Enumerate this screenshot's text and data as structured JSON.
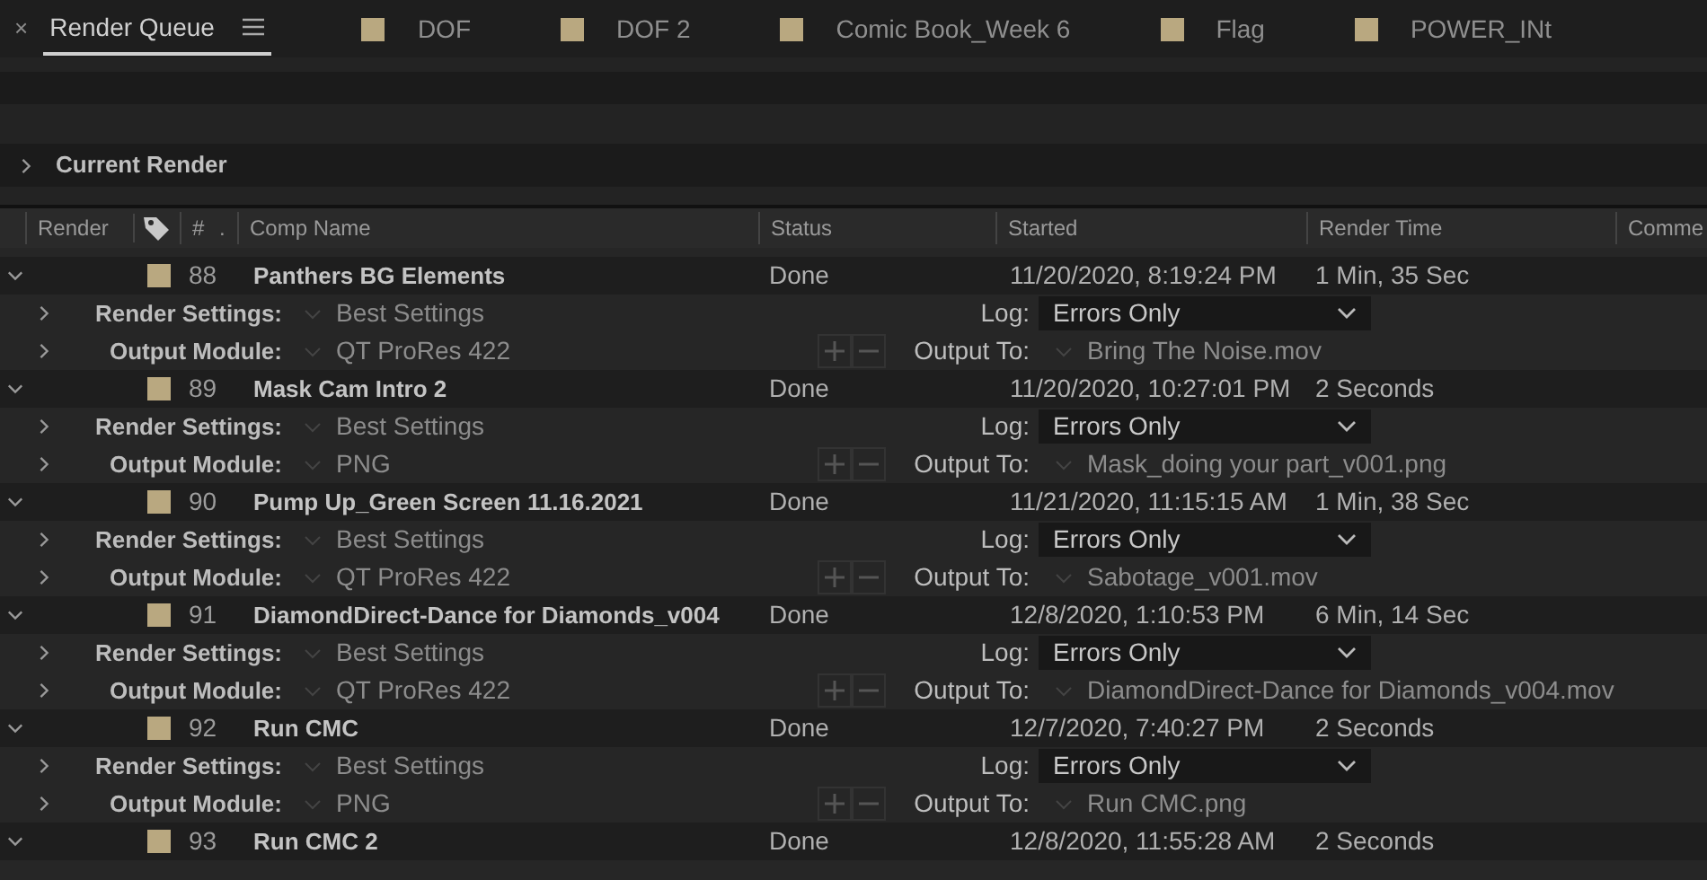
{
  "tabs": [
    {
      "kind": "queue",
      "label": "Render Queue",
      "selected": true
    },
    {
      "kind": "comp",
      "label": "DOF",
      "selected": false
    },
    {
      "kind": "comp",
      "label": "DOF 2",
      "selected": false
    },
    {
      "kind": "comp",
      "label": "Comic Book_Week 6",
      "selected": false
    },
    {
      "kind": "comp",
      "label": "Flag",
      "selected": false
    },
    {
      "kind": "comp",
      "label": "POWER_INt",
      "selected": false
    }
  ],
  "close_tab": "×",
  "current_render": {
    "label": "Current Render",
    "expanded": false
  },
  "columns": [
    "Render",
    "#",
    ".",
    "Comp Name",
    "Status",
    "Started",
    "Render Time",
    "Comme"
  ],
  "items": [
    {
      "number": "88",
      "name": "Panthers BG Elements",
      "status": "Done",
      "started": "11/20/2020, 8:19:24 PM",
      "render_time": "1 Min, 35 Sec",
      "expanded": true,
      "render_settings_label": "Render Settings:",
      "render_settings": "Best Settings",
      "log_label": "Log:",
      "log": "Errors Only",
      "output_module_label": "Output Module:",
      "output_module": "QT ProRes 422",
      "output_to_label": "Output To:",
      "output_to": "Bring The Noise.mov"
    },
    {
      "number": "89",
      "name": "Mask Cam Intro 2",
      "status": "Done",
      "started": "11/20/2020, 10:27:01 PM",
      "render_time": "2 Seconds",
      "expanded": true,
      "render_settings_label": "Render Settings:",
      "render_settings": "Best Settings",
      "log_label": "Log:",
      "log": "Errors Only",
      "output_module_label": "Output Module:",
      "output_module": "PNG",
      "output_to_label": "Output To:",
      "output_to": "Mask_doing your part_v001.png"
    },
    {
      "number": "90",
      "name": "Pump Up_Green Screen 11.16.2021",
      "status": "Done",
      "started": "11/21/2020, 11:15:15 AM",
      "render_time": "1 Min, 38 Sec",
      "expanded": true,
      "render_settings_label": "Render Settings:",
      "render_settings": "Best Settings",
      "log_label": "Log:",
      "log": "Errors Only",
      "output_module_label": "Output Module:",
      "output_module": "QT ProRes 422",
      "output_to_label": "Output To:",
      "output_to": "Sabotage_v001.mov"
    },
    {
      "number": "91",
      "name": "DiamondDirect-Dance for Diamonds_v004",
      "status": "Done",
      "started": "12/8/2020, 1:10:53 PM",
      "render_time": "6 Min, 14 Sec",
      "expanded": true,
      "render_settings_label": "Render Settings:",
      "render_settings": "Best Settings",
      "log_label": "Log:",
      "log": "Errors Only",
      "output_module_label": "Output Module:",
      "output_module": "QT ProRes 422",
      "output_to_label": "Output To:",
      "output_to": "DiamondDirect-Dance for Diamonds_v004.mov"
    },
    {
      "number": "92",
      "name": "Run CMC",
      "status": "Done",
      "started": "12/7/2020, 7:40:27 PM",
      "render_time": "2 Seconds",
      "expanded": true,
      "render_settings_label": "Render Settings:",
      "render_settings": "Best Settings",
      "log_label": "Log:",
      "log": "Errors Only",
      "output_module_label": "Output Module:",
      "output_module": "PNG",
      "output_to_label": "Output To:",
      "output_to": "Run CMC.png"
    },
    {
      "number": "93",
      "name": "Run CMC 2",
      "status": "Done",
      "started": "12/8/2020, 11:55:28 AM",
      "render_time": "2 Seconds",
      "expanded": true
    }
  ]
}
